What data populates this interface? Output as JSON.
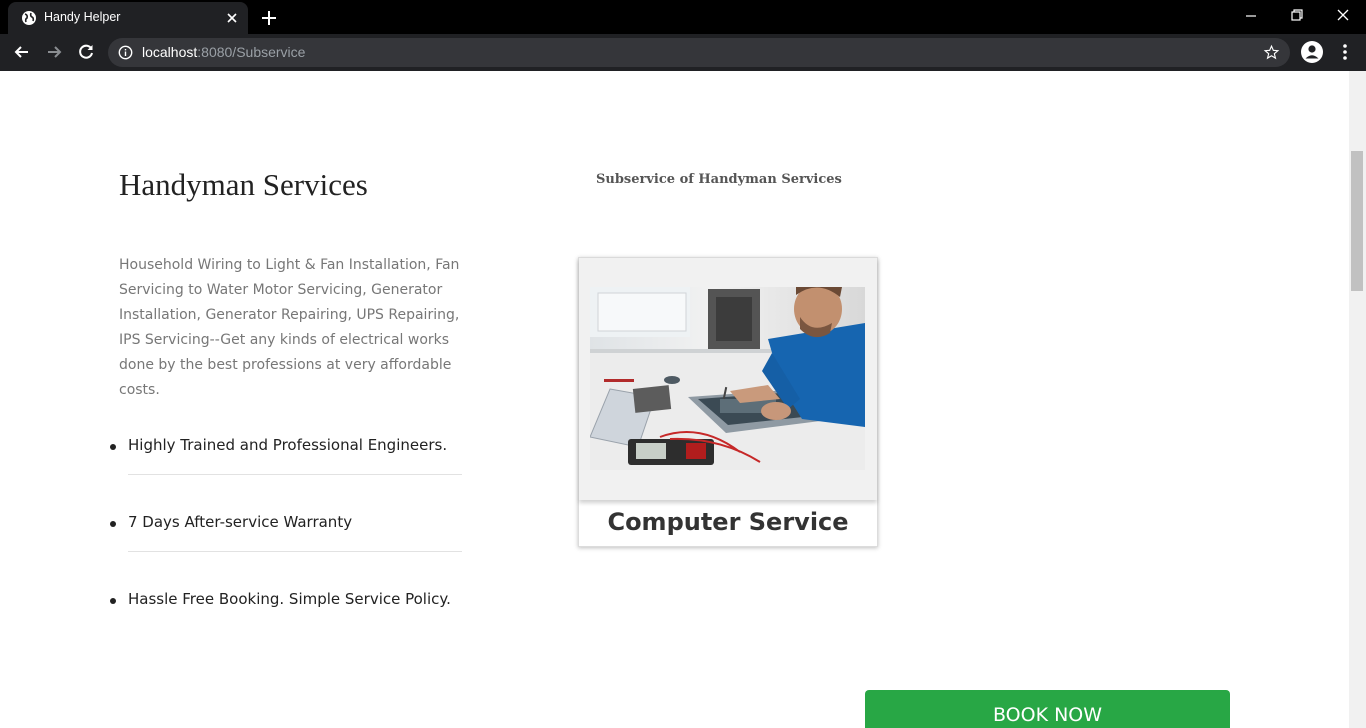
{
  "browser": {
    "tab_title": "Handy Helper",
    "url_host": "localhost",
    "url_rest": ":8080/Subservice",
    "icons": {
      "favicon": "globe-icon",
      "tab_close": "close-icon",
      "new_tab": "plus-icon",
      "back": "back-arrow-icon",
      "forward": "forward-arrow-icon",
      "reload": "reload-icon",
      "site_info": "info-icon",
      "bookmark": "star-icon",
      "profile": "profile-icon",
      "menu": "kebab-menu-icon"
    }
  },
  "page": {
    "heading": "Handyman Services",
    "description": "Household Wiring to Light & Fan Installation, Fan Servicing to Water Motor Servicing, Generator Installation, Generator Repairing, UPS Repairing, IPS Servicing--Get any kinds of electrical works done by the best professions at very affordable costs.",
    "features": [
      "Highly Trained and Professional Engineers.",
      "7 Days After-service Warranty",
      "Hassle Free Booking. Simple Service Policy."
    ],
    "subservice_heading": "Subservice of Handyman Services",
    "card": {
      "title": "Computer Service",
      "image_icon": "technician-repairing-laptop-image"
    },
    "book_button": "BOOK NOW",
    "colors": {
      "book_button": "#28a745",
      "browser_frame": "#202124"
    }
  }
}
